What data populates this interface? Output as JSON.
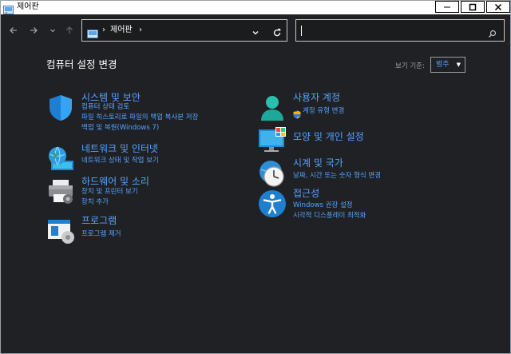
{
  "window": {
    "title": "제어판"
  },
  "address": {
    "crumb": "제어판",
    "sep1": "›",
    "sep2": "›"
  },
  "search": {
    "placeholder": ""
  },
  "main": {
    "heading": "컴퓨터 설정 변경",
    "view_by_label": "보기 기준:",
    "view_by_value": "범주"
  },
  "left_categories": [
    {
      "title": "시스템 및 보안",
      "links": [
        "컴퓨터 상태 검토",
        "파일 히스토리로 파일의 백업 복사본 저장",
        "백업 및 복원(Windows 7)"
      ]
    },
    {
      "title": "네트워크 및 인터넷",
      "links": [
        "네트워크 상태 및 작업 보기"
      ]
    },
    {
      "title": "하드웨어 및 소리",
      "links": [
        "장치 및 프린터 보기",
        "장치 추가"
      ]
    },
    {
      "title": "프로그램",
      "links": [
        "프로그램 제거"
      ]
    }
  ],
  "right_categories": [
    {
      "title": "사용자 계정",
      "links": [
        "계정 유형 변경"
      ]
    },
    {
      "title": "모양 및 개인 설정",
      "links": []
    },
    {
      "title": "시계 및 국가",
      "links": [
        "날짜, 시간 또는 숫자 형식 변경"
      ]
    },
    {
      "title": "접근성",
      "links": [
        "Windows 권장 설정",
        "시각적 디스플레이 최적화"
      ]
    }
  ],
  "colors": {
    "link": "#55a3ff",
    "background": "#202124",
    "titlebar": "#ffffff"
  }
}
